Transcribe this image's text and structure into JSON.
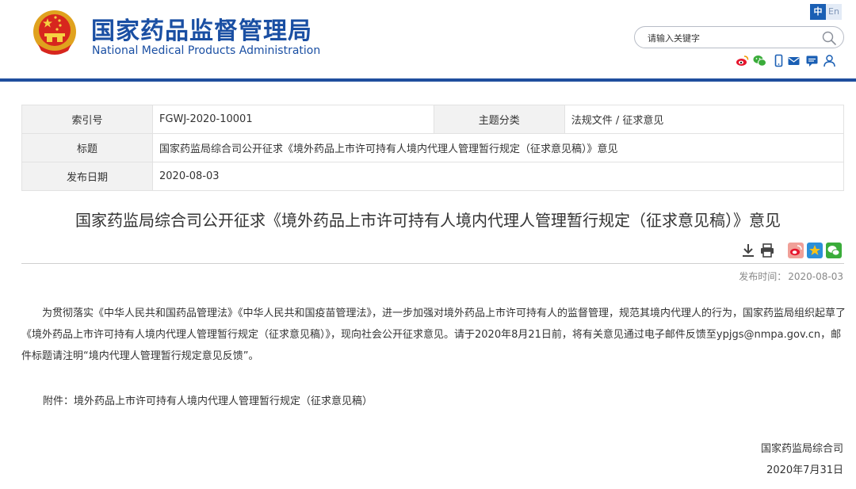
{
  "header": {
    "site_name_cn": "国家药品监督管理局",
    "site_name_en": "National Medical Products Administration",
    "lang_zh": "中",
    "lang_en": "En",
    "search_placeholder": "请输入关键字",
    "social_icons": [
      "weibo-icon",
      "wechat-icon",
      "mobile-icon",
      "mail-icon",
      "message-icon",
      "user-icon"
    ]
  },
  "colors": {
    "brand_blue": "#1a4fa3",
    "divider_blue": "#1f4e9e",
    "label_bg": "#f2f2f2"
  },
  "meta": {
    "index_label": "索引号",
    "index_value": "FGWJ-2020-10001",
    "category_label": "主题分类",
    "category_value": "法规文件 / 征求意见",
    "title_label": "标题",
    "title_value": "国家药监局综合司公开征求《境外药品上市许可持有人境内代理人管理暂行规定（征求意见稿）》意见",
    "date_label": "发布日期",
    "date_value": "2020-08-03"
  },
  "article": {
    "title": "国家药监局综合司公开征求《境外药品上市许可持有人境内代理人管理暂行规定（征求意见稿）》意见",
    "tool_icons": [
      "download-icon",
      "print-icon",
      "weibo-share-icon",
      "qzone-share-icon",
      "wechat-share-icon"
    ],
    "publish_time_label": "发布时间：",
    "publish_time_value": "2020-08-03",
    "body": "为贯彻落实《中华人民共和国药品管理法》《中华人民共和国疫苗管理法》，进一步加强对境外药品上市许可持有人的监督管理，规范其境内代理人的行为，国家药监局组织起草了《境外药品上市许可持有人境内代理人管理暂行规定（征求意见稿）》，现向社会公开征求意见。请于2020年8月21日前，将有关意见通过电子邮件反馈至ypjgs@nmpa.gov.cn，邮件标题请注明“境内代理人管理暂行规定意见反馈”。",
    "attachment": "附件：境外药品上市许可持有人境内代理人管理暂行规定（征求意见稿）",
    "sign_org": "国家药监局综合司",
    "sign_date": "2020年7月31日"
  }
}
